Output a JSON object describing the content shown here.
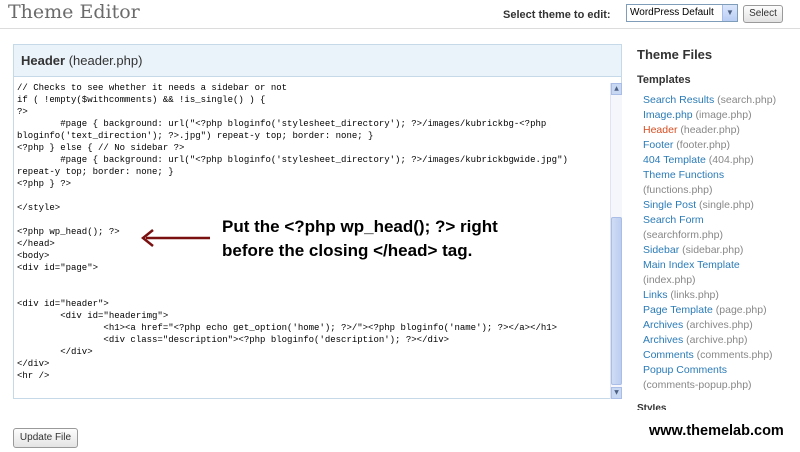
{
  "page_title": "Theme Editor",
  "theme_selector": {
    "label": "Select theme to edit:",
    "selected": "WordPress Default",
    "button": "Select"
  },
  "editor": {
    "title_bold": "Header",
    "title_file": "(header.php)",
    "lines": [
      "// Checks to see whether it needs a sidebar or not",
      "if ( !empty($withcomments) && !is_single() ) {",
      "?>",
      "        #page { background: url(\"<?php bloginfo('stylesheet_directory'); ?>/images/kubrickbg-<?php",
      "bloginfo('text_direction'); ?>.jpg\") repeat-y top; border: none; }",
      "<?php } else { // No sidebar ?>",
      "        #page { background: url(\"<?php bloginfo('stylesheet_directory'); ?>/images/kubrickbgwide.jpg\")",
      "repeat-y top; border: none; }",
      "<?php } ?>",
      "",
      "</style>",
      "",
      "<?php wp_head(); ?>",
      "</head>",
      "<body>",
      "<div id=\"page\">",
      "",
      "",
      "<div id=\"header\">",
      "        <div id=\"headerimg\">",
      "                <h1><a href=\"<?php echo get_option('home'); ?>/\"><?php bloginfo('name'); ?></a></h1>",
      "                <div class=\"description\"><?php bloginfo('description'); ?></div>",
      "        </div>",
      "</div>",
      "<hr />"
    ],
    "update_button": "Update File"
  },
  "callout": {
    "line1": "Put the <?php wp_head(); ?> right",
    "line2": "before the closing </head> tag."
  },
  "sidebar": {
    "heading": "Theme Files",
    "templates_heading": "Templates",
    "templates": [
      {
        "name": "Search Results",
        "file": "(search.php)",
        "current": false
      },
      {
        "name": "Image.php",
        "file": "(image.php)",
        "current": false
      },
      {
        "name": "Header",
        "file": "(header.php)",
        "current": true
      },
      {
        "name": "Footer",
        "file": "(footer.php)",
        "current": false
      },
      {
        "name": "404 Template",
        "file": "(404.php)",
        "current": false
      },
      {
        "name": "Theme Functions",
        "file": "",
        "current": false
      },
      {
        "name": "",
        "file": "(functions.php)",
        "current": false
      },
      {
        "name": "Single Post",
        "file": "(single.php)",
        "current": false
      },
      {
        "name": "Search Form",
        "file": "",
        "current": false
      },
      {
        "name": "",
        "file": "(searchform.php)",
        "current": false
      },
      {
        "name": "Sidebar",
        "file": "(sidebar.php)",
        "current": false
      },
      {
        "name": "Main Index Template",
        "file": "",
        "current": false
      },
      {
        "name": "",
        "file": "(index.php)",
        "current": false
      },
      {
        "name": "Links",
        "file": "(links.php)",
        "current": false
      },
      {
        "name": "Page Template",
        "file": "(page.php)",
        "current": false
      },
      {
        "name": "Archives",
        "file": "(archives.php)",
        "current": false
      },
      {
        "name": "Archives",
        "file": "(archive.php)",
        "current": false
      },
      {
        "name": "Comments",
        "file": "(comments.php)",
        "current": false
      },
      {
        "name": "Popup Comments",
        "file": "",
        "current": false
      },
      {
        "name": "",
        "file": "(comments-popup.php)",
        "current": false
      }
    ],
    "styles_heading": "Styles"
  },
  "watermark": "www.themelab.com",
  "colors": {
    "link": "#2a7bb7",
    "current_link": "#d54e21",
    "panel_header": "#eaf3fa",
    "arrow": "#7a1010"
  }
}
